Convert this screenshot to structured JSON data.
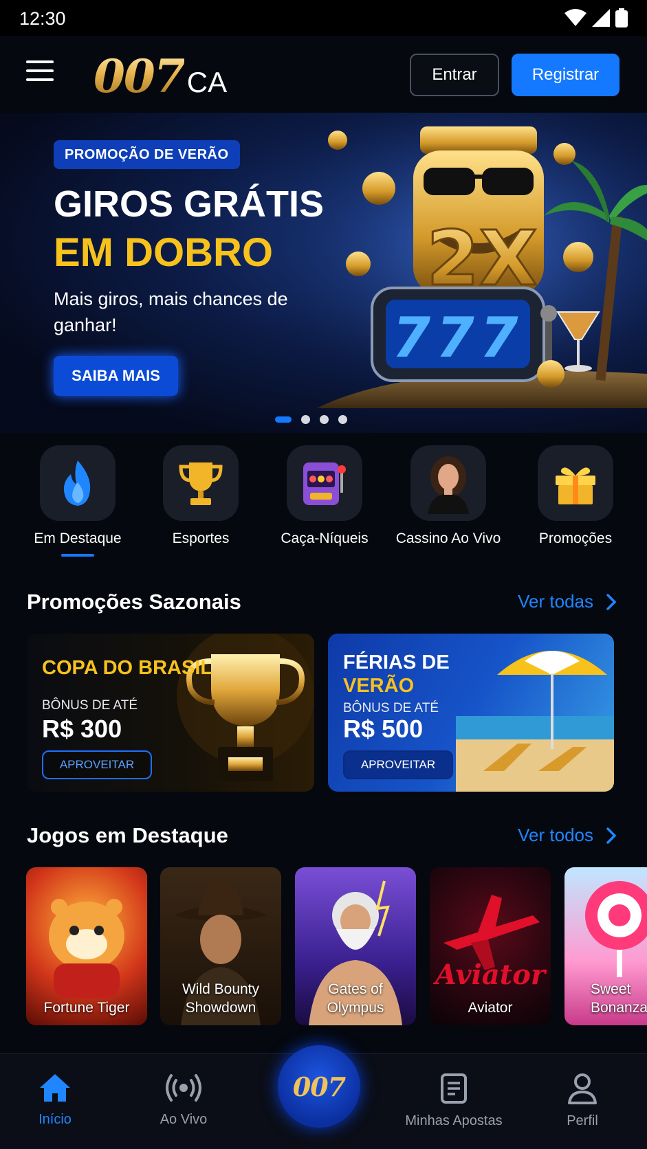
{
  "status": {
    "time": "12:30"
  },
  "header": {
    "logo_main": "007",
    "logo_sub": "CA",
    "login_label": "Entrar",
    "register_label": "Registrar"
  },
  "hero": {
    "badge": "PROMOÇÃO DE VERÃO",
    "title_line1": "GIROS GRÁTIS",
    "title_line2": "EM DOBRO",
    "subtitle": "Mais giros, mais chances de ganhar!",
    "cta": "SAIBA MAIS",
    "art_text_multiplier": "2X",
    "art_text_reels": "777",
    "slides_total": 4,
    "active_slide": 1
  },
  "categories": [
    {
      "label": "Em Destaque",
      "icon": "flame-icon",
      "active": true
    },
    {
      "label": "Esportes",
      "icon": "trophy-icon",
      "active": false
    },
    {
      "label": "Caça-Níqueis",
      "icon": "slot-machine-icon",
      "active": false
    },
    {
      "label": "Cassino Ao Vivo",
      "icon": "live-dealer-icon",
      "active": false
    },
    {
      "label": "Promoções",
      "icon": "gift-icon",
      "active": false
    }
  ],
  "seasonal": {
    "title": "Promoções Sazonais",
    "link": "Ver todas",
    "cards": [
      {
        "title_line1": "COPA DO BRASIL",
        "title_line2": "",
        "bonus_label": "BÔNUS DE ATÉ",
        "amount": "R$ 300",
        "button": "APROVEITAR"
      },
      {
        "title_line1": "FÉRIAS DE",
        "title_line2": "VERÃO",
        "bonus_label": "BÔNUS DE ATÉ",
        "amount": "R$ 500",
        "button": "APROVEITAR"
      }
    ]
  },
  "featured_games": {
    "title": "Jogos em Destaque",
    "link": "Ver todos",
    "games": [
      {
        "line1": "Fortune Tiger",
        "line2": ""
      },
      {
        "line1": "Wild Bounty",
        "line2": "Showdown"
      },
      {
        "line1": "Gates of",
        "line2": "Olympus"
      },
      {
        "line1": "Aviator",
        "line2": ""
      },
      {
        "line1": "Sweet",
        "line2": "Bonanza"
      }
    ]
  },
  "bottom_nav": {
    "home": "Início",
    "live": "Ao Vivo",
    "center": "007",
    "bets": "Minhas Apostas",
    "profile": "Perfil"
  },
  "colors": {
    "accent": "#1479ff",
    "gold": "#f7c21c",
    "background": "#05080f"
  }
}
